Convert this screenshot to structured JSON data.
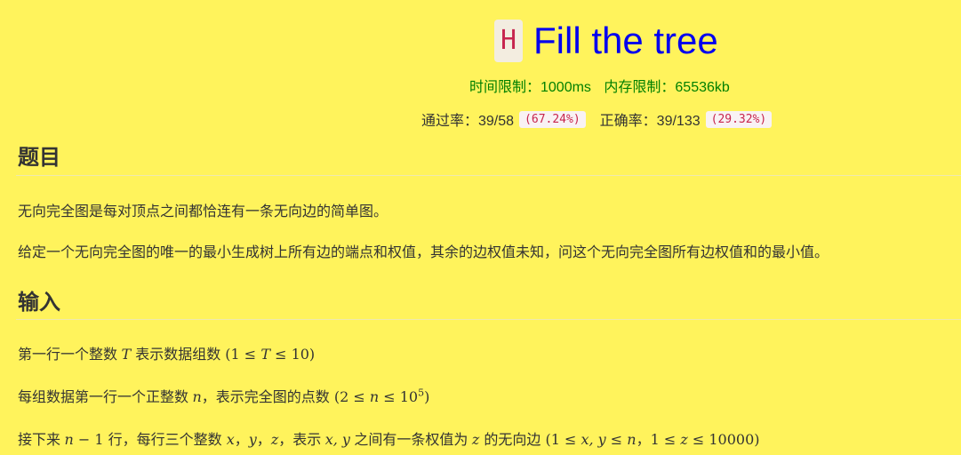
{
  "problem": {
    "letter": "H",
    "title": "Fill the tree",
    "time_limit": "时间限制：1000ms",
    "memory_limit": "内存限制：65536kb"
  },
  "stats": {
    "pass_label": "通过率：39/58",
    "pass_pct": "(67.24%)",
    "acc_label": "正确率：39/133",
    "acc_pct": "(29.32%)"
  },
  "sections": {
    "problem_heading": "题目",
    "problem_p1": "无向完全图是每对顶点之间都恰连有一条无向边的简单图。",
    "problem_p2": "给定一个无向完全图的唯一的最小生成树上所有边的端点和权值，其余的边权值未知，问这个无向完全图所有边权值和的最小值。",
    "input_heading": "输入",
    "input_l1_a": "第一行一个整数 ",
    "input_l1_var": "T",
    "input_l1_b": " 表示数据组数 (1 ≤ ",
    "input_l1_var2": "T",
    "input_l1_c": " ≤ 10)",
    "input_l2_a": "每组数据第一行一个正整数 ",
    "input_l2_var": "n",
    "input_l2_b": "，表示完全图的点数 (2 ≤ ",
    "input_l2_var2": "n",
    "input_l2_c": " ≤ 10",
    "input_l2_sup": "5",
    "input_l2_d": ")",
    "input_l3_a": "接下来 ",
    "input_l3_var": "n",
    "input_l3_b": " − 1 行，每行三个整数 ",
    "input_l3_x": "x",
    "input_l3_sep1": "，",
    "input_l3_y": "y",
    "input_l3_sep2": "，",
    "input_l3_z": "z",
    "input_l3_c": "，表示 ",
    "input_l3_xy": "x, y",
    "input_l3_d": " 之间有一条权值为 ",
    "input_l3_z2": "z",
    "input_l3_e": " 的无向边 (1 ≤ ",
    "input_l3_xy2": "x, y",
    "input_l3_f": " ≤ ",
    "input_l3_n2": "n",
    "input_l3_g": "，1 ≤ ",
    "input_l3_z3": "z",
    "input_l3_h": " ≤ 10000)"
  },
  "colors": {
    "background": "#fff35c",
    "title": "#0000ee",
    "limits": "#008000",
    "badge_text": "#c7254e"
  }
}
